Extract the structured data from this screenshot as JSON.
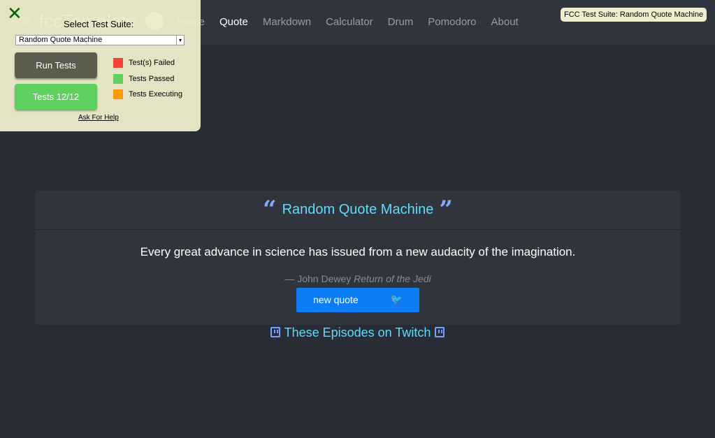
{
  "navbar": {
    "brand": "fccTemplate",
    "links": [
      {
        "label": "Home"
      },
      {
        "label": "Quote"
      },
      {
        "label": "Markdown"
      },
      {
        "label": "Calculator"
      },
      {
        "label": "Drum"
      },
      {
        "label": "Pomodoro"
      },
      {
        "label": "About"
      }
    ],
    "active": "Quote"
  },
  "suite_badge": "FCC Test Suite: Random Quote Machine",
  "fcc_panel": {
    "close_symbol": "✕",
    "select_label": "Select Test Suite:",
    "selected_suite": "Random Quote Machine",
    "run_tests_label": "Run Tests",
    "tests_result_label": "Tests 12/12",
    "legend": [
      {
        "label": "Test(s) Failed",
        "color": "#f44336"
      },
      {
        "label": "Tests Passed",
        "color": "#5ed05e"
      },
      {
        "label": "Tests Executing",
        "color": "#ff9800"
      }
    ],
    "help_link": "Ask For Help"
  },
  "card": {
    "title": "Random Quote Machine",
    "quote": "Every great advance in science has issued from a new audacity of the imagination.",
    "author": "— John Dewey",
    "source": "Return of the Jedi",
    "new_quote_label": "new quote"
  },
  "twitch_link": "These Episodes on Twitch",
  "colors": {
    "background": "#282c34",
    "navbar": "#30343c",
    "accent": "#61dafb",
    "button": "#0d7df5",
    "panel": "#eeeecc"
  }
}
